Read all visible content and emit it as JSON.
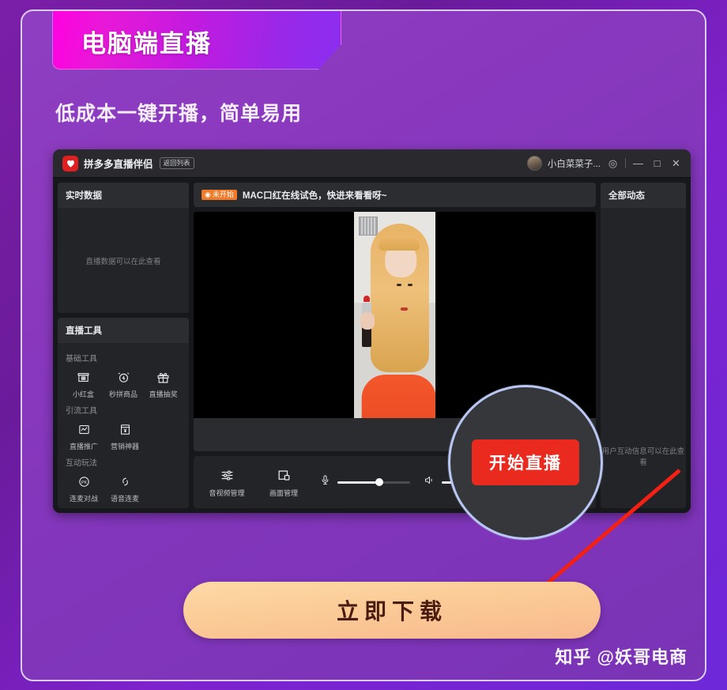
{
  "header": {
    "banner_title": "电脑端直播",
    "banner_gradient_from": "#ff00e0",
    "banner_gradient_to": "#8b2ef0",
    "subtitle": "低成本一键开播，简单易用"
  },
  "app": {
    "titlebar": {
      "logo_icon": "pinduoduo-heart-icon",
      "app_name": "拼多多直播伴侣",
      "back_button": "返回列表",
      "user_name": "小白菜菜子...",
      "settings_icon": "gear-icon",
      "minimize_icon": "minimize-icon",
      "maximize_icon": "maximize-icon",
      "close_icon": "close-icon",
      "minimize_glyph": "—",
      "maximize_glyph": "□",
      "close_glyph": "✕",
      "settings_glyph": "◎"
    },
    "left": {
      "realtime_panel_title": "实时数据",
      "realtime_panel_hint": "直播数据可以在此查看",
      "tools_panel_title": "直播工具",
      "tool_groups": [
        {
          "label": "基础工具",
          "items": [
            {
              "label": "小红盒",
              "icon": "red-box-icon"
            },
            {
              "label": "秒拼商品",
              "icon": "alarm-clock-icon"
            },
            {
              "label": "直播抽奖",
              "icon": "gift-icon"
            }
          ]
        },
        {
          "label": "引流工具",
          "items": [
            {
              "label": "直播推广",
              "icon": "chart-square-icon"
            },
            {
              "label": "营销神器",
              "icon": "yuan-document-icon"
            }
          ]
        },
        {
          "label": "互动玩法",
          "items": [
            {
              "label": "连麦对战",
              "icon": "pk-circle-icon"
            },
            {
              "label": "语音连麦",
              "icon": "link-loop-icon"
            }
          ]
        }
      ]
    },
    "center": {
      "status_badge": "未开始",
      "status_badge_color": "#f07a28",
      "stream_title": "MAC口红在线试色，快进来看看呀~",
      "bottom_tools": [
        {
          "label": "音视频管理",
          "icon": "sliders-icon"
        },
        {
          "label": "画面管理",
          "icon": "screen-layout-icon"
        }
      ],
      "mic_slider": {
        "icon": "microphone-icon",
        "value": 58
      },
      "speaker_slider": {
        "icon": "speaker-icon",
        "value": 45
      }
    },
    "right": {
      "panel_title": "全部动态",
      "panel_hint": "用户互动信息可以在此查看"
    }
  },
  "highlight": {
    "start_live_label": "开始直播",
    "start_live_color": "#ea2a1f",
    "circle_color": "#b9c7f5",
    "arrow_color": "#f32013",
    "arrow_icon": "red-arrow-icon"
  },
  "cta": {
    "download_label": "立即下载"
  },
  "watermark": {
    "text": "知乎 @妖哥电商"
  }
}
